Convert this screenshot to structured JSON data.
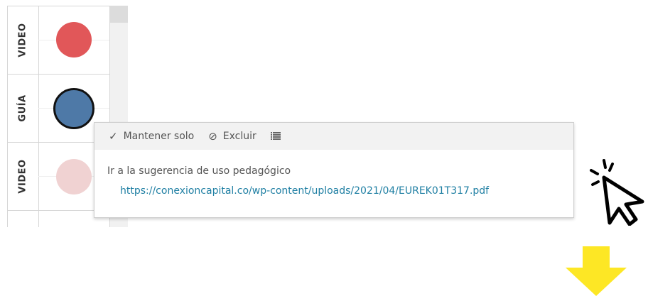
{
  "rows": [
    {
      "label": "VIDEO",
      "color": "#e15759"
    },
    {
      "label": "GUÍA",
      "color": "#4e79a7"
    },
    {
      "label": "VIDEO",
      "color": "#f0d2d2"
    }
  ],
  "tooltip": {
    "keep_only_label": "Mantener solo",
    "exclude_label": "Excluir",
    "text": "Ir a la sugerencia de uso pedagógico",
    "link": "https://conexioncapital.co/wp-content/uploads/2021/04/EUREK01T317.pdf"
  },
  "icons": {
    "keep_only": "check-icon",
    "exclude": "ban-icon",
    "view_data": "table-icon",
    "cursor": "pointer-click-icon",
    "arrow": "arrow-down-icon"
  },
  "colors": {
    "link": "#1f7fa3",
    "arrow": "#fde725"
  }
}
